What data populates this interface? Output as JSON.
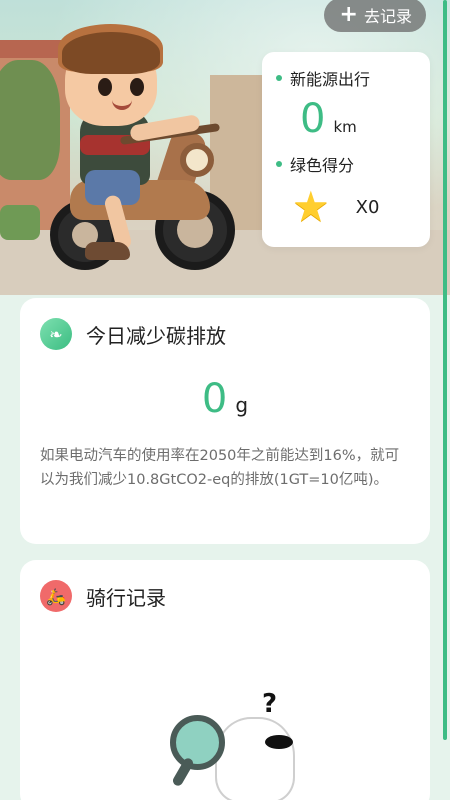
{
  "header": {
    "add_record_label": "去记录"
  },
  "stats": {
    "distance_label": "新能源出行",
    "distance_value": "0",
    "distance_unit": "km",
    "score_label": "绿色得分",
    "score_value": "X0"
  },
  "carbon": {
    "title": "今日减少碳排放",
    "value": "0",
    "unit": "g",
    "description": "如果电动汽车的使用率在2050年之前能达到16%，就可以为我们减少10.8GtCO2-eq的排放(1GT=10亿吨)。"
  },
  "record": {
    "title": "骑行记录"
  },
  "colors": {
    "accent_green": "#3ebc85",
    "record_red": "#f06a6a"
  },
  "icons": {
    "add": "plus-icon",
    "leaf": "leaf-icon",
    "moto": "motorcycle-icon",
    "star": "star-icon",
    "empty": "empty-state-illustration"
  }
}
